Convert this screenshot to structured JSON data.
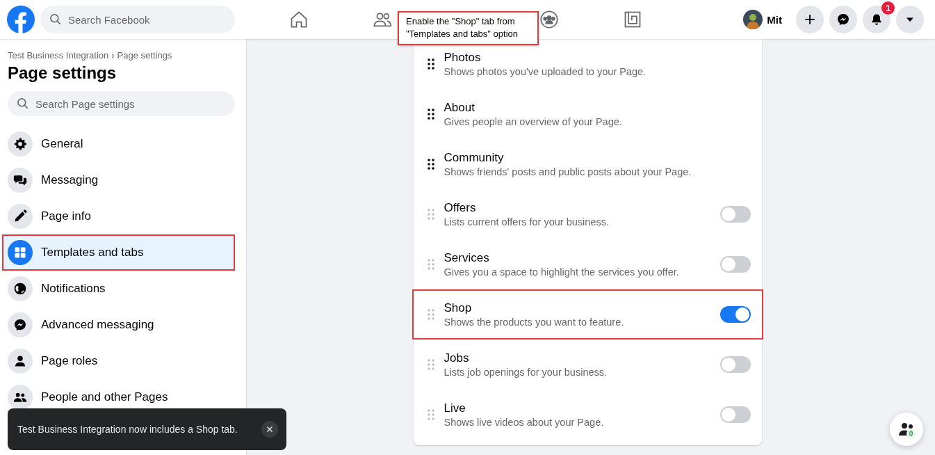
{
  "header": {
    "search_placeholder": "Search Facebook",
    "nav": [
      {
        "kind": "home"
      },
      {
        "kind": "friends"
      },
      {
        "kind": "groups"
      },
      {
        "kind": "gaming"
      }
    ],
    "profile_name": "Mit",
    "actions": [
      {
        "kind": "create"
      },
      {
        "kind": "messenger"
      },
      {
        "kind": "notifications",
        "badge": "1"
      },
      {
        "kind": "account"
      }
    ]
  },
  "callout": {
    "text": "Enable the \"Shop\" tab from\n\"Templates and tabs\" option"
  },
  "sidebar": {
    "breadcrumb": {
      "parent": "Test Business Integration",
      "separator": "›",
      "current": "Page settings"
    },
    "title": "Page settings",
    "search_placeholder": "Search Page settings",
    "items": [
      {
        "kind": "general",
        "label": "General",
        "selected": false,
        "highlighted": false
      },
      {
        "kind": "messaging",
        "label": "Messaging",
        "selected": false,
        "highlighted": false
      },
      {
        "kind": "info",
        "label": "Page info",
        "selected": false,
        "highlighted": false
      },
      {
        "kind": "templates",
        "label": "Templates and tabs",
        "selected": true,
        "highlighted": true
      },
      {
        "kind": "notifications",
        "label": "Notifications",
        "selected": false,
        "highlighted": false
      },
      {
        "kind": "advanced",
        "label": "Advanced messaging",
        "selected": false,
        "highlighted": false
      },
      {
        "kind": "roles",
        "label": "Page roles",
        "selected": false,
        "highlighted": false
      },
      {
        "kind": "people",
        "label": "People and other Pages",
        "selected": false,
        "highlighted": false
      }
    ]
  },
  "tabs": [
    {
      "kind": "fixed",
      "title": "Photos",
      "description": "Shows photos you've uploaded to your Page.",
      "highlighted": false
    },
    {
      "kind": "fixed",
      "title": "About",
      "description": "Gives people an overview of your Page.",
      "highlighted": false
    },
    {
      "kind": "fixed",
      "title": "Community",
      "description": "Shows friends' posts and public posts about your Page.",
      "highlighted": false
    },
    {
      "kind": "toggle",
      "title": "Offers",
      "description": "Lists current offers for your business.",
      "on": false,
      "highlighted": false
    },
    {
      "kind": "toggle",
      "title": "Services",
      "description": "Gives you a space to highlight the services you offer.",
      "on": false,
      "highlighted": false
    },
    {
      "kind": "toggle",
      "title": "Shop",
      "description": "Shows the products you want to feature.",
      "on": true,
      "highlighted": true
    },
    {
      "kind": "toggle",
      "title": "Jobs",
      "description": "Lists job openings for your business.",
      "on": false,
      "highlighted": false
    },
    {
      "kind": "toggle",
      "title": "Live",
      "description": "Shows live videos about your Page.",
      "on": false,
      "highlighted": false
    }
  ],
  "toast": {
    "message": "Test Business Integration now includes a Shop tab."
  },
  "contacts": {
    "badge": "0"
  }
}
